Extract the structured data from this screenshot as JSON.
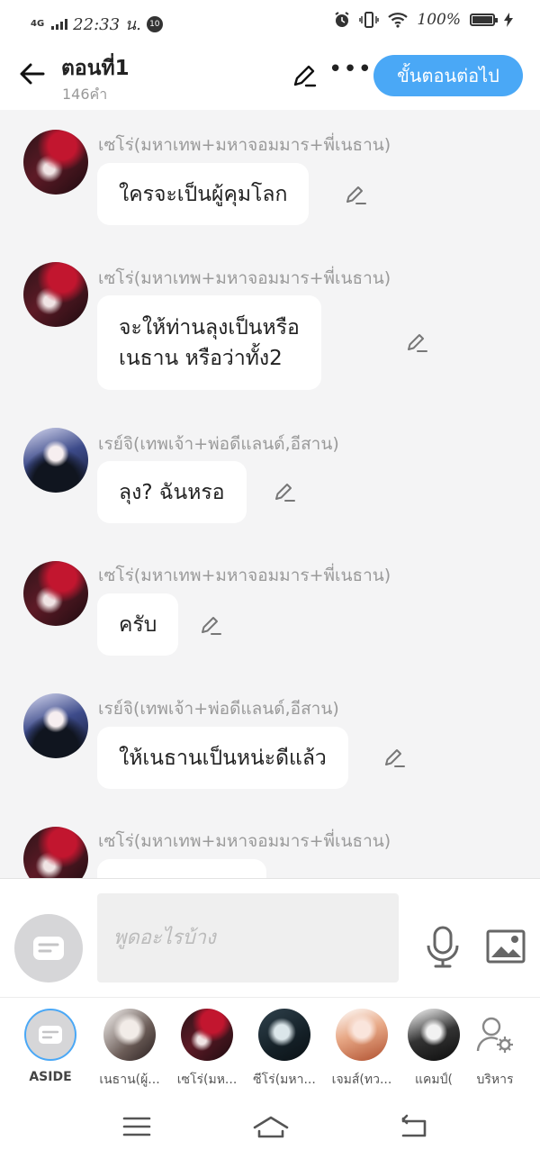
{
  "status_bar": {
    "network": "4G",
    "time": "22:33 น.",
    "notification_count": "10",
    "battery": "100%"
  },
  "header": {
    "title": "ตอนที่1",
    "word_count": "146คำ",
    "next_button": "ขั้นตอนต่อไป"
  },
  "messages": [
    {
      "sender": "เซโร่(มหาเทพ+มหาจอมมาร+พี่เนธาน)",
      "lines": [
        "ใครจะเป็นผู้คุมโลก"
      ],
      "avatar": "zero-avatar"
    },
    {
      "sender": "เซโร่(มหาเทพ+มหาจอมมาร+พี่เนธาน)",
      "lines": [
        "จะให้ท่านลุงเป็นหรือ",
        "เนธาน หรือว่าทั้ง2"
      ],
      "avatar": "zero-avatar"
    },
    {
      "sender": "เรย์จิ(เทพเจ้า+พ่อดีแลนด์,อีสาน)",
      "lines": [
        "ลุง? ฉันหรอ"
      ],
      "avatar": "reiji-avatar"
    },
    {
      "sender": "เซโร่(มหาเทพ+มหาจอมมาร+พี่เนธาน)",
      "lines": [
        "ครับ"
      ],
      "avatar": "zero-avatar"
    },
    {
      "sender": "เรย์จิ(เทพเจ้า+พ่อดีแลนด์,อีสาน)",
      "lines": [
        "ให้เนธานเป็นหน่ะดีแล้ว"
      ],
      "avatar": "reiji-avatar"
    },
    {
      "sender": "เซโร่(มหาเทพ+มหาจอมมาร+พี่เนธาน)",
      "lines": [
        ""
      ],
      "avatar": "zero-avatar"
    }
  ],
  "composer": {
    "placeholder": "พูดอะไรบ้าง"
  },
  "characters": [
    {
      "name": "ASIDE"
    },
    {
      "name": "เนธาน(ผู้..."
    },
    {
      "name": "เซโร่(มห..."
    },
    {
      "name": "ซีโร่(มหา..."
    },
    {
      "name": "เจมส์(ทว..."
    },
    {
      "name": "แคมป์("
    },
    {
      "name": "บริหาร"
    }
  ],
  "colors": {
    "accent": "#4aa8f6",
    "background": "#f4f4f5",
    "bubble": "#ffffff",
    "sender_text": "#9a9a9a"
  }
}
